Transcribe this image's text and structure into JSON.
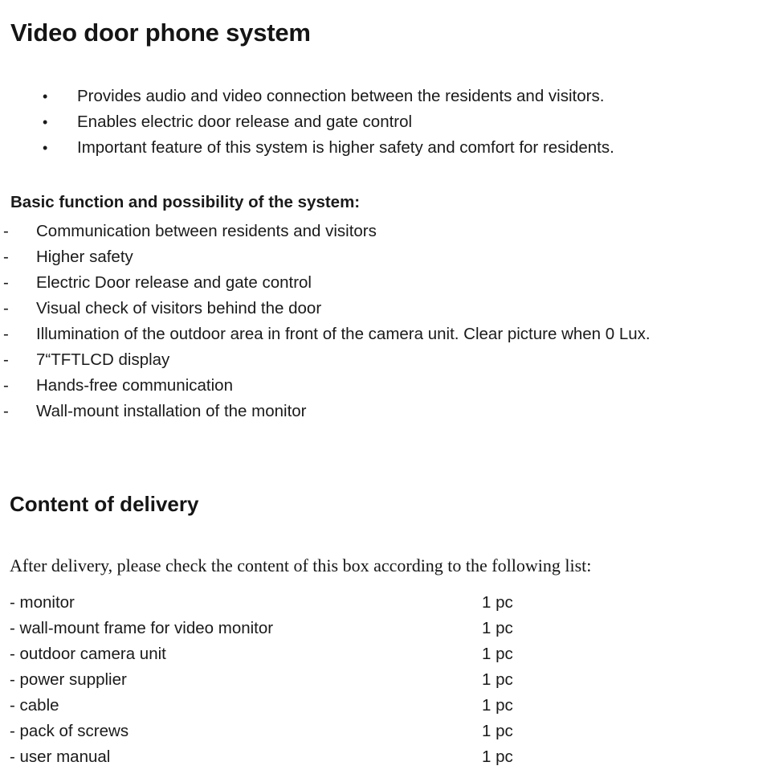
{
  "document": {
    "title": "Video door phone system"
  },
  "intro_bullets": {
    "marker": "•",
    "items": [
      "Provides audio and video connection between the residents and visitors.",
      "Enables electric door release and gate control",
      "Important feature of this system is higher safety and comfort for residents."
    ]
  },
  "basic_function": {
    "heading": "Basic function and possibility of the system:",
    "marker": "-",
    "items": [
      "Communication between residents and visitors",
      "Higher safety",
      "Electric Door release and gate control",
      "Visual check of visitors behind the door",
      "Illumination of the outdoor area in front of the camera unit. Clear picture when 0 Lux.",
      "7“TFTLCD display",
      "Hands-free communication",
      "Wall-mount installation of the monitor"
    ]
  },
  "content_of_delivery": {
    "heading": "Content of delivery",
    "intro": "After delivery, please check the content of this box according to the following list:",
    "items": [
      {
        "name": "- monitor",
        "qty": "1 pc"
      },
      {
        "name": "- wall-mount frame for video monitor",
        "qty": "1 pc"
      },
      {
        "name": "- outdoor camera unit",
        "qty": "1 pc"
      },
      {
        "name": "- power supplier",
        "qty": "1 pc"
      },
      {
        "name": "- cable",
        "qty": "1 pc"
      },
      {
        "name": "- pack of screws",
        "qty": "1 pc"
      },
      {
        "name": "- user manual",
        "qty": "1 pc"
      }
    ]
  },
  "colors": {
    "text": "#1a1a1a",
    "heading": "#151515",
    "background": "#ffffff"
  }
}
